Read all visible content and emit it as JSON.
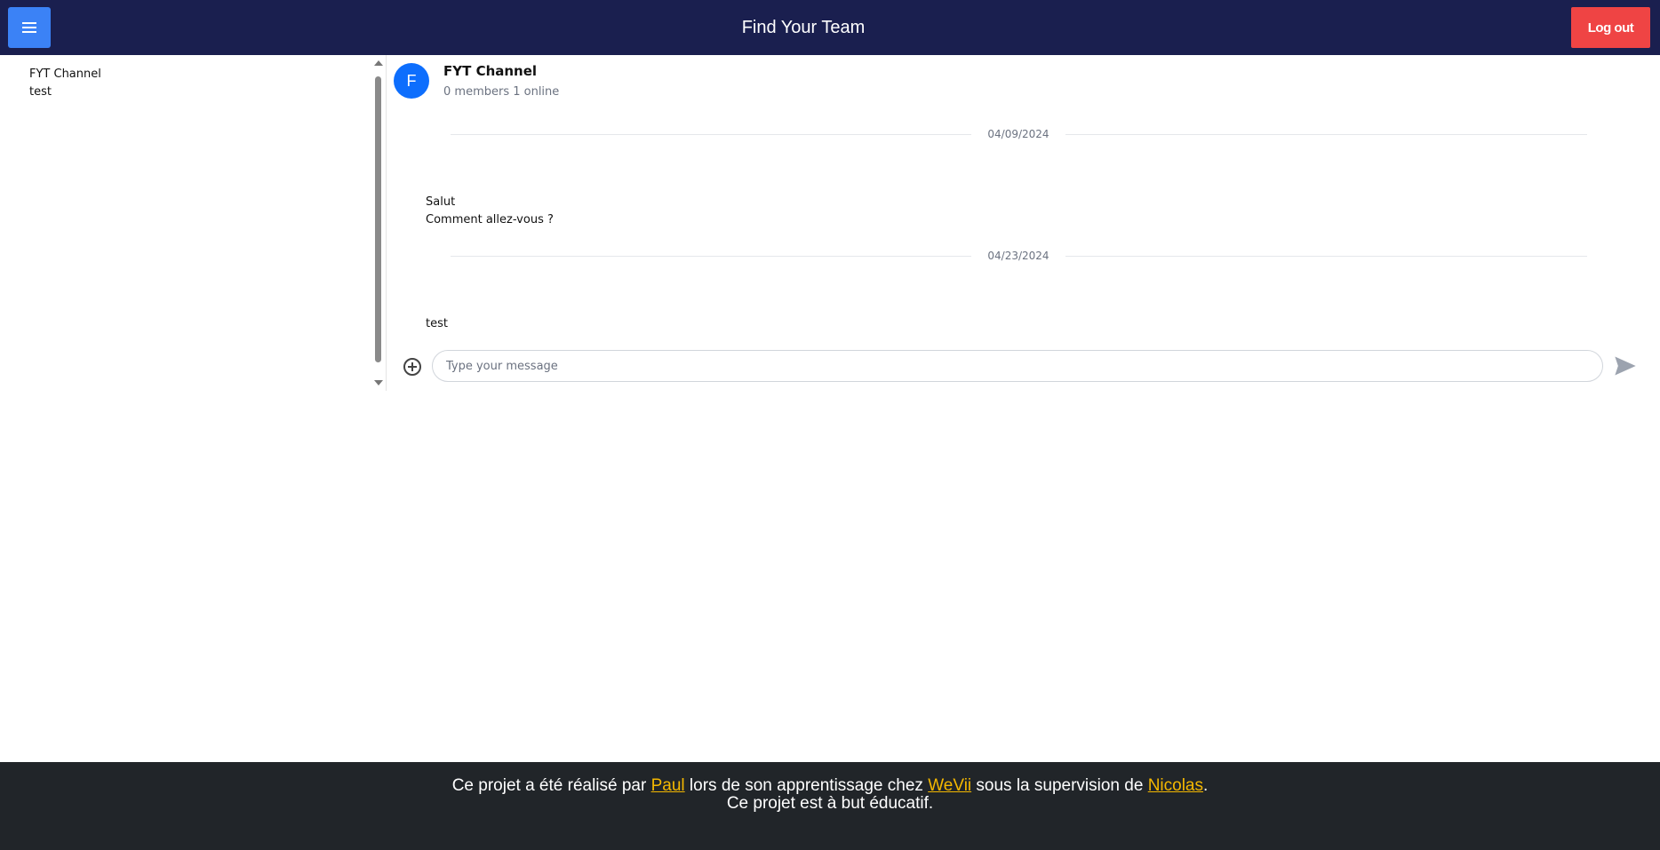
{
  "header": {
    "title": "Find Your Team",
    "logout_label": "Log out",
    "menu_icon": "hamburger-menu-icon"
  },
  "sidebar": {
    "channels": [
      {
        "label": "FYT Channel"
      },
      {
        "label": "test"
      }
    ]
  },
  "chat": {
    "avatar_letter": "F",
    "channel_name": "FYT Channel",
    "member_info": "0 members 1 online",
    "groups": [
      {
        "date": "04/09/2024",
        "messages": [
          "Salut",
          "Comment allez-vous ?"
        ]
      },
      {
        "date": "04/23/2024",
        "messages": [
          "test"
        ]
      }
    ],
    "input_placeholder": "Type your message",
    "input_value": "",
    "attach_icon": "plus-circle-icon",
    "send_icon": "send-icon"
  },
  "footer": {
    "prefix": "Ce projet a été réalisé par ",
    "author_link": "Paul",
    "mid1": " lors de son apprentissage chez ",
    "company_link": "WeVii",
    "mid2": " sous la supervision de ",
    "supervisor_link": "Nicolas",
    "suffix": ".",
    "line2": "Ce projet est à but éducatif."
  },
  "colors": {
    "header_bg": "#1a1f4f",
    "menu_button": "#3b82f6",
    "logout_button": "#ef4444",
    "avatar": "#0d6efd",
    "footer_bg": "#212529",
    "footer_link": "#f5b800"
  }
}
